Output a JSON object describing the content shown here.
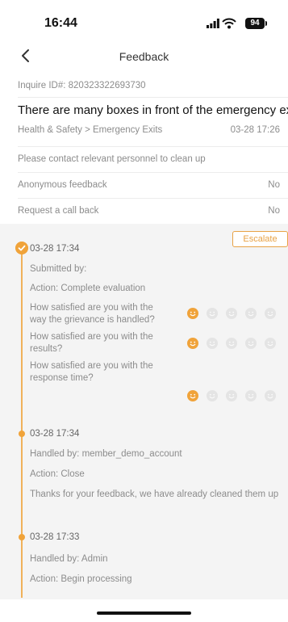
{
  "status": {
    "time": "16:44",
    "battery": "94"
  },
  "nav": {
    "title": "Feedback"
  },
  "card": {
    "inquire_id": "Inquire ID#: 820323322693730",
    "subject": "There are many boxes in front of the emergency exit",
    "category": "Health & Safety > Emergency Exits",
    "date": "03-28 17:26",
    "instruction": "Please contact relevant personnel to clean up",
    "anonymous_label": "Anonymous feedback",
    "anonymous_value": "No",
    "callback_label": "Request a call back",
    "callback_value": "No"
  },
  "escalate_label": "Escalate",
  "timeline": [
    {
      "time": "03-28 17:34",
      "line1": "Submitted by:",
      "line2": "Action: Complete evaluation",
      "questions": [
        {
          "text": "How satisfied are you with the way the grievance is handled?",
          "rating": 1
        },
        {
          "text": "How satisfied are you with the results?",
          "rating": 1
        },
        {
          "text": "How satisfied are you with the response time?",
          "rating": 1
        }
      ]
    },
    {
      "time": "03-28 17:34",
      "line1": "Handled by: member_demo_account",
      "line2": "Action: Close",
      "note": "Thanks for your feedback, we have already cleaned them up"
    },
    {
      "time": "03-28 17:33",
      "line1": "Handled by: Admin",
      "line2": "Action: Begin processing"
    }
  ],
  "colors": {
    "accent": "#f0a33a",
    "escalate": "#e8a245",
    "muted": "#8c8c8c"
  },
  "icons": {
    "back": "chevron-left-icon",
    "rating": "smiley-face-icon",
    "complete": "check-circle-icon"
  }
}
